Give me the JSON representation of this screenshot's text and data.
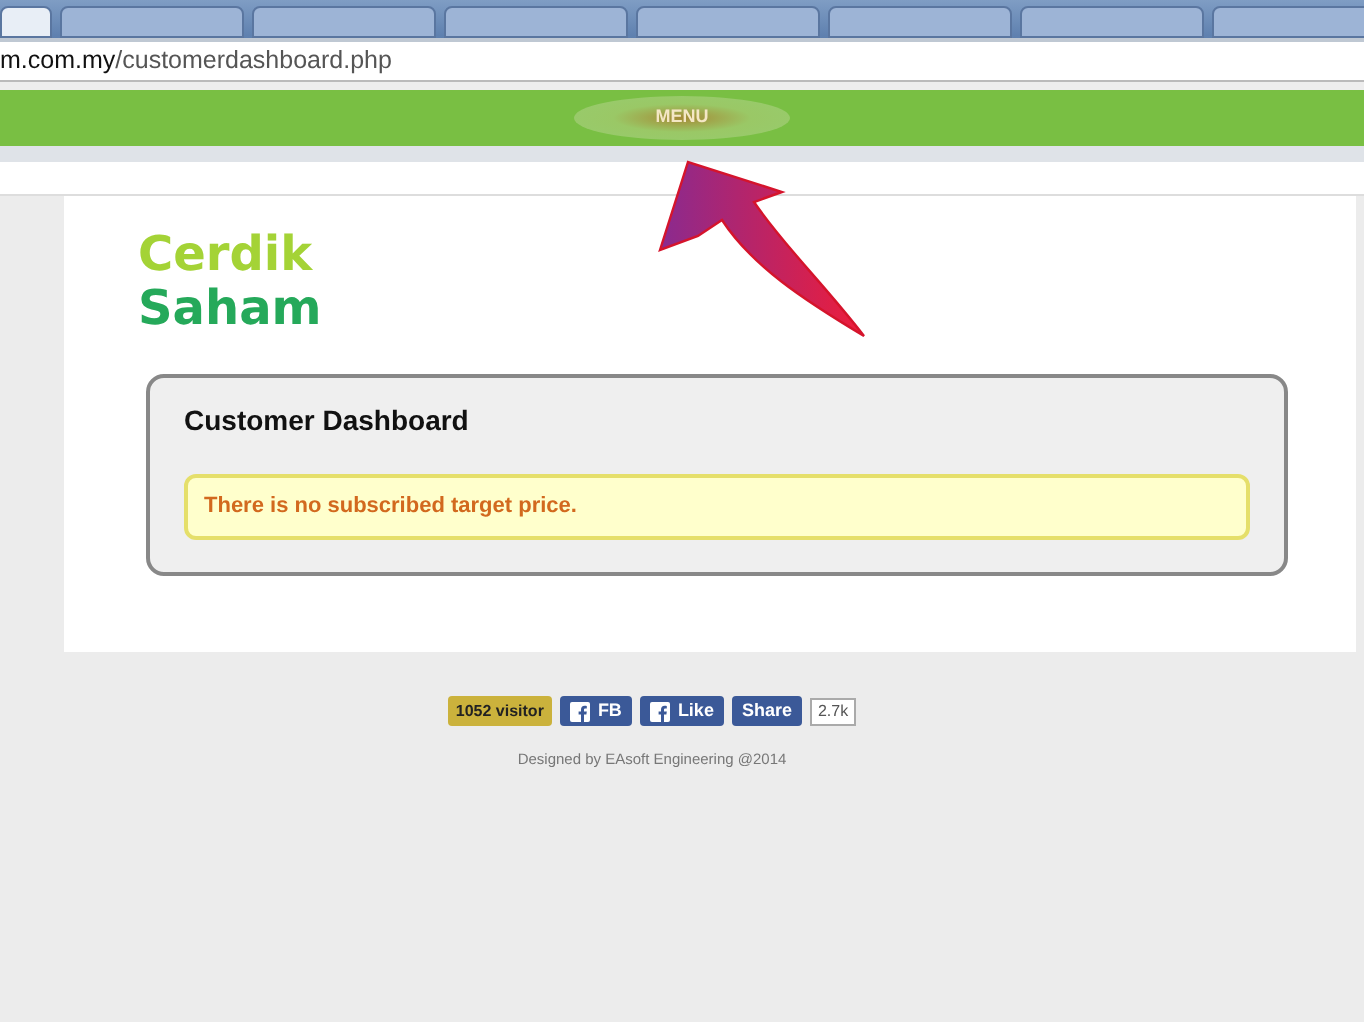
{
  "browser": {
    "tabs": [
      {
        "selected": true
      },
      {
        "selected": false
      },
      {
        "selected": false
      },
      {
        "selected": false
      },
      {
        "selected": false
      },
      {
        "selected": false
      },
      {
        "selected": false
      },
      {
        "selected": false
      }
    ],
    "address": {
      "host": "m.com.my",
      "path": "/customerdashboard.php"
    }
  },
  "navbar": {
    "menu": "MENU"
  },
  "logo": {
    "line_1": "Cerdik",
    "line_2": "Saham"
  },
  "dashboard": {
    "title": "Customer Dashboard",
    "alert": "There is no subscribed target price."
  },
  "footer": {
    "visitors": "1052 visitor",
    "fb": "FB",
    "like": "Like",
    "share": "Share",
    "share_count": "2.7k",
    "credit": "Designed by EAsoft Engineering @2014"
  }
}
